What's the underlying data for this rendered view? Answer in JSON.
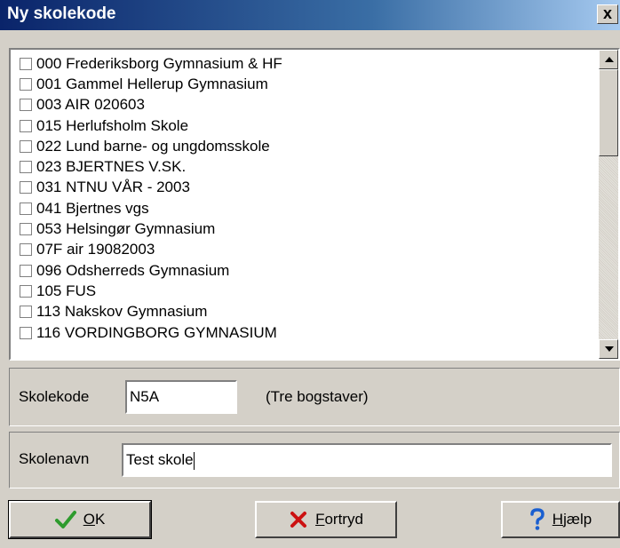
{
  "window": {
    "title": "Ny skolekode",
    "close_glyph": "x"
  },
  "school_list": {
    "items": [
      {
        "label": "000 Frederiksborg Gymnasium & HF",
        "checked": false
      },
      {
        "label": "001 Gammel Hellerup Gymnasium",
        "checked": false
      },
      {
        "label": "003 AIR 020603",
        "checked": false
      },
      {
        "label": "015 Herlufsholm Skole",
        "checked": false
      },
      {
        "label": "022 Lund barne- og ungdomsskole",
        "checked": false
      },
      {
        "label": "023 BJERTNES V.SK.",
        "checked": false
      },
      {
        "label": "031 NTNU VÅR - 2003",
        "checked": false
      },
      {
        "label": "041 Bjertnes vgs",
        "checked": false
      },
      {
        "label": "053 Helsingør Gymnasium",
        "checked": false
      },
      {
        "label": "07F air 19082003",
        "checked": false
      },
      {
        "label": "096 Odsherreds Gymnasium",
        "checked": false
      },
      {
        "label": "105 FUS",
        "checked": false
      },
      {
        "label": "113 Nakskov Gymnasium",
        "checked": false
      },
      {
        "label": "116 VORDINGBORG GYMNASIUM",
        "checked": false
      }
    ]
  },
  "school_code": {
    "label": "Skolekode",
    "value": "N5A",
    "hint": "(Tre bogstaver)"
  },
  "school_name": {
    "label": "Skolenavn",
    "value": "Test skole"
  },
  "buttons": {
    "ok": {
      "label": "OK",
      "mnemonic": "O",
      "rest": "K",
      "icon": "checkmark-icon"
    },
    "cancel": {
      "label": "Fortryd",
      "mnemonic": "F",
      "rest": "ortryd",
      "icon": "cross-icon"
    },
    "help": {
      "label": "Hjælp",
      "mnemonic": "H",
      "rest": "jælp",
      "icon": "question-icon"
    }
  },
  "colors": {
    "title_start": "#0a246a",
    "title_end": "#a6caf0",
    "face": "#d4d0c8",
    "check_green": "#2e9b2e",
    "cross_red": "#cc1111",
    "help_blue": "#1a5fd0"
  }
}
